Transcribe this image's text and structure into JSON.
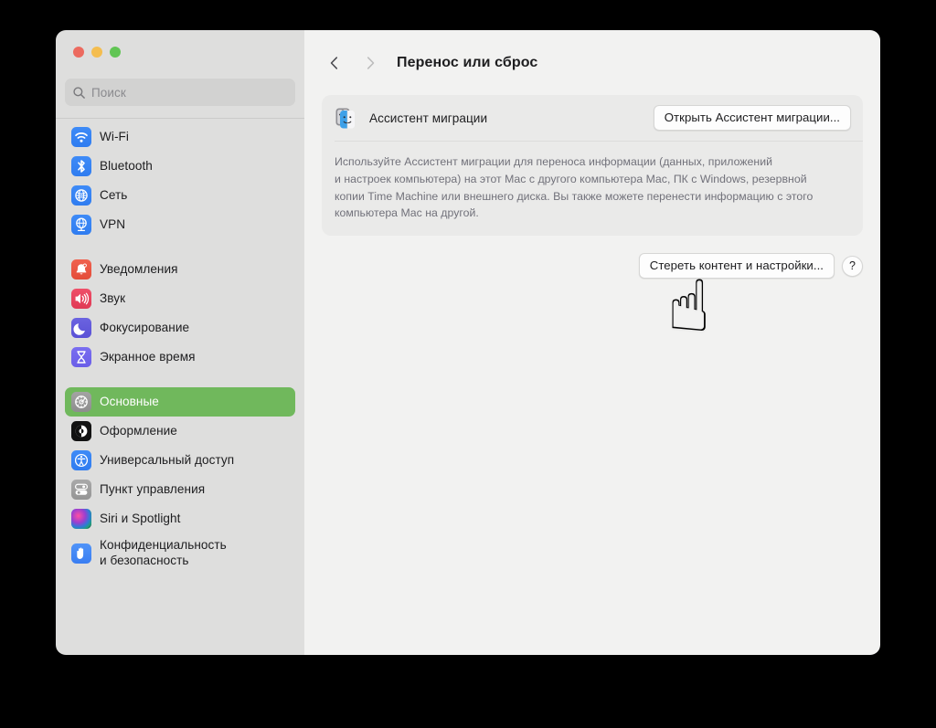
{
  "window": {
    "traffic_lights": [
      "close",
      "minimize",
      "zoom"
    ],
    "colors": {
      "accent_selected": "#70b85c",
      "sidebar_bg": "#dededd",
      "main_bg": "#f2f2f1",
      "card_bg": "#eaeae9",
      "close_red": "#ec6a5f",
      "minimize_yellow": "#f4bd4f",
      "zoom_green": "#61c554"
    }
  },
  "search": {
    "placeholder": "Поиск",
    "value": "",
    "icon": "search-icon"
  },
  "sidebar": {
    "groups": [
      {
        "items": [
          {
            "label": "Wi-Fi",
            "icon": "wifi-icon",
            "selected": false
          },
          {
            "label": "Bluetooth",
            "icon": "bluetooth-icon",
            "selected": false
          },
          {
            "label": "Сеть",
            "icon": "network-globe-icon",
            "selected": false
          },
          {
            "label": "VPN",
            "icon": "vpn-globe-icon",
            "selected": false
          }
        ]
      },
      {
        "items": [
          {
            "label": "Уведомления",
            "icon": "bell-icon",
            "selected": false
          },
          {
            "label": "Звук",
            "icon": "speaker-icon",
            "selected": false
          },
          {
            "label": "Фокусирование",
            "icon": "moon-icon",
            "selected": false
          },
          {
            "label": "Экранное время",
            "icon": "hourglass-icon",
            "selected": false
          }
        ]
      },
      {
        "items": [
          {
            "label": "Основные",
            "icon": "gear-icon",
            "selected": true
          },
          {
            "label": "Оформление",
            "icon": "appearance-icon",
            "selected": false
          },
          {
            "label": "Универсальный доступ",
            "icon": "accessibility-icon",
            "selected": false
          },
          {
            "label": "Пункт управления",
            "icon": "control-center-icon",
            "selected": false
          },
          {
            "label": "Siri и Spotlight",
            "icon": "siri-icon",
            "selected": false
          },
          {
            "label": "Конфиденциальность\nи безопасность",
            "icon": "hand-privacy-icon",
            "selected": false
          }
        ]
      }
    ]
  },
  "main": {
    "nav": {
      "back_icon": "chevron-left-icon",
      "forward_icon": "chevron-right-icon",
      "back_enabled": true,
      "forward_enabled": false
    },
    "title": "Перенос или сброс",
    "migration_card": {
      "icon": "migration-assistant-icon",
      "label": "Ассистент миграции",
      "button_label": "Открыть Ассистент миграции...",
      "description": "Используйте Ассистент миграции для переноса информации (данных, приложений\nи настроек компьютера) на этот Mac с другого компьютера Mac, ПК с Windows, резервной\nкопии Time Machine или внешнего диска. Вы также можете перенести информацию с этого\nкомпьютера Mac на другой."
    },
    "erase": {
      "button_label": "Стереть контент и настройки...",
      "help_label": "?"
    },
    "cursor": {
      "icon": "pointing-up-hand-cursor",
      "glyph": "☝"
    }
  }
}
